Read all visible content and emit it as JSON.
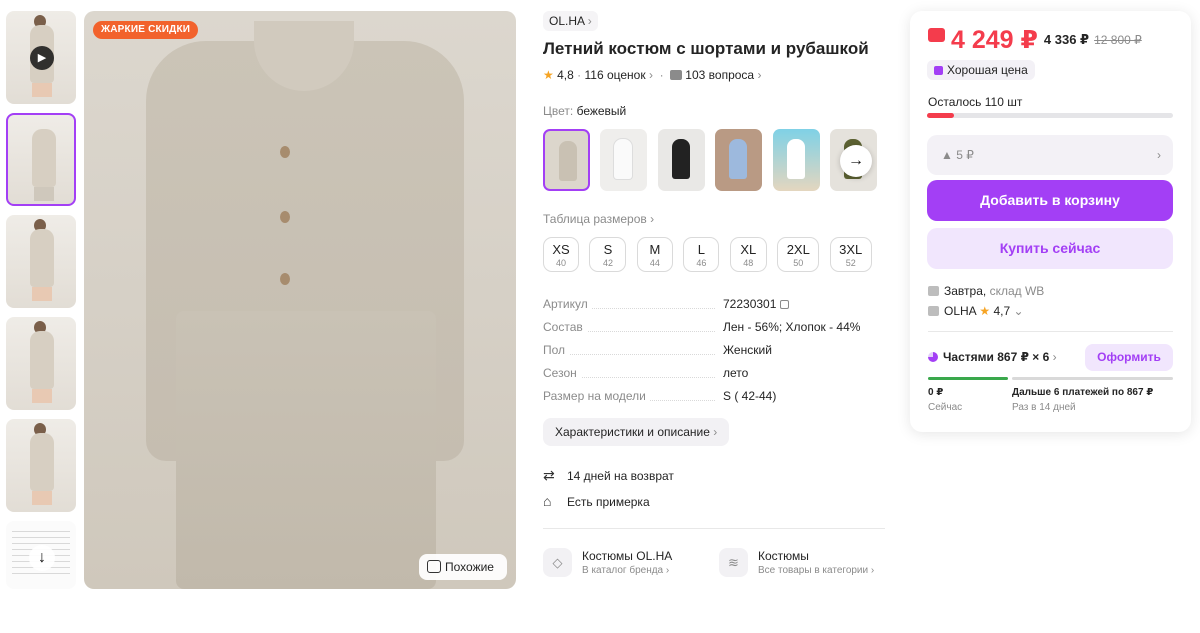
{
  "gallery": {
    "hot_badge": "ЖАРКИЕ СКИДКИ",
    "similar_label": "Похожие",
    "thumb_count": 6
  },
  "product": {
    "brand": "OL.HA",
    "title": "Летний костюм с шортами и рубашкой",
    "rating": "4,8",
    "reviews": "116 оценок",
    "questions": "103 вопроса",
    "color_label": "Цвет:",
    "color_value": "бежевый",
    "size_table_label": "Таблица размеров",
    "sizes": [
      {
        "size": "XS",
        "ru": "40"
      },
      {
        "size": "S",
        "ru": "42"
      },
      {
        "size": "M",
        "ru": "44"
      },
      {
        "size": "L",
        "ru": "46"
      },
      {
        "size": "XL",
        "ru": "48"
      },
      {
        "size": "2XL",
        "ru": "50"
      },
      {
        "size": "3XL",
        "ru": "52"
      }
    ],
    "params": [
      {
        "key": "Артикул",
        "value": "72230301"
      },
      {
        "key": "Состав",
        "value": "Лен - 56%; Хлопок - 44%"
      },
      {
        "key": "Пол",
        "value": "Женский"
      },
      {
        "key": "Сезон",
        "value": "лето"
      },
      {
        "key": "Размер на модели",
        "value": "S ( 42-44)"
      }
    ],
    "chars_button": "Характеристики и описание",
    "features": [
      "14 дней на возврат",
      "Есть примерка"
    ],
    "brand_card": {
      "title": "Костюмы OL.HA",
      "sub": "В каталог бренда"
    },
    "category_card": {
      "title": "Костюмы",
      "sub": "Все товары в категории"
    }
  },
  "buy": {
    "price": "4 249 ₽",
    "price_wallet_alt": "4 336 ₽",
    "price_old": "12 800 ₽",
    "good_price": "Хорошая цена",
    "stock_label": "Осталось 110 шт",
    "stock_fraction": 0.11,
    "qty": "5 ₽",
    "add_to_cart": "Добавить в корзину",
    "buy_now": "Купить сейчас",
    "delivery_day": "Завтра,",
    "delivery_where": "склад WB",
    "seller": "OLHA",
    "seller_rating": "4,7",
    "parts_label": "Частями 867 ₽ × 6",
    "parts_button": "Оформить",
    "pay_now_amount": "0 ₽",
    "pay_now_label": "Сейчас",
    "pay_later_amount": "Дальше 6 платежей по 867 ₽",
    "pay_later_label": "Раз в 14 дней"
  },
  "colors": {
    "accent": "#a33ff5",
    "price_red": "#f43c4c",
    "hot_orange": "#f2622c",
    "star": "#f6a424",
    "pay_green": "#3aa84c"
  },
  "icons": [
    "play-icon",
    "arrow-down-icon",
    "similar-icon",
    "star-icon",
    "question-icon",
    "chevron-right-icon",
    "arrow-right-icon",
    "copy-icon",
    "return-icon",
    "hanger-icon",
    "tag-icon",
    "layers-icon",
    "wallet-icon",
    "thumb-up-icon",
    "warehouse-icon",
    "store-icon",
    "chevron-down-icon",
    "installment-icon"
  ]
}
